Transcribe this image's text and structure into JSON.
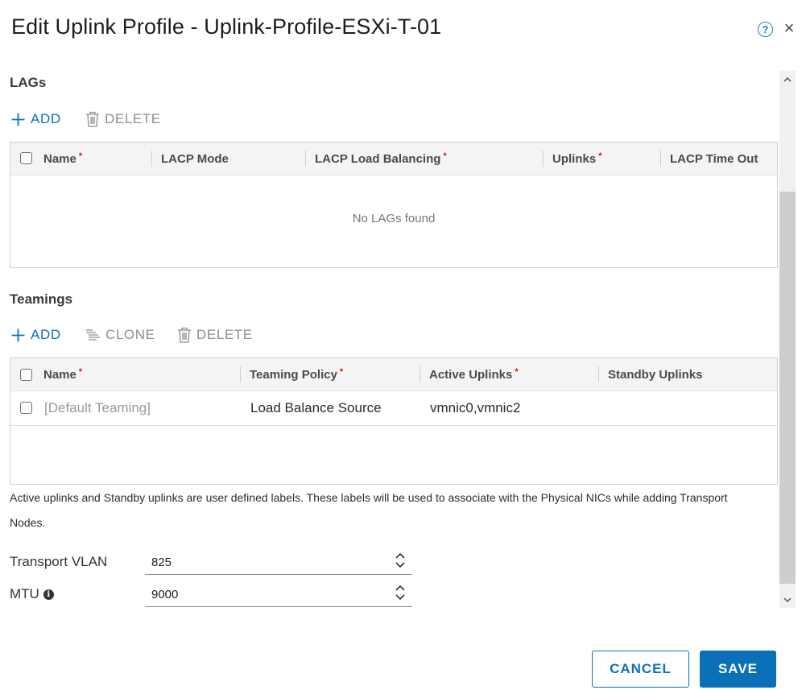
{
  "dialog": {
    "title": "Edit Uplink Profile - Uplink-Profile-ESXi-T-01",
    "help_glyph": "?",
    "close_glyph": "×"
  },
  "lags": {
    "section_title": "LAGs",
    "add_label": "ADD",
    "delete_label": "DELETE",
    "columns": [
      "Name",
      "LACP Mode",
      "LACP Load Balancing",
      "Uplinks",
      "LACP Time Out"
    ],
    "required_marker": "*",
    "empty_message": "No LAGs found"
  },
  "teamings": {
    "section_title": "Teamings",
    "add_label": "ADD",
    "clone_label": "CLONE",
    "delete_label": "DELETE",
    "columns": [
      "Name",
      "Teaming Policy",
      "Active Uplinks",
      "Standby Uplinks"
    ],
    "required_marker": "*",
    "rows": [
      {
        "name": "[Default Teaming]",
        "policy": "Load Balance Source",
        "active": "vmnic0,vmnic2",
        "standby": ""
      }
    ]
  },
  "note": "Active uplinks and Standby uplinks are user defined labels. These labels will be used to associate with the Physical NICs while adding Transport Nodes.",
  "fields": {
    "transport_vlan": {
      "label": "Transport VLAN",
      "value": "825"
    },
    "mtu": {
      "label": "MTU",
      "value": "9000",
      "info_glyph": "i"
    }
  },
  "footer": {
    "cancel_label": "CANCEL",
    "save_label": "SAVE"
  },
  "colors": {
    "accent": "#0a71b8",
    "required": "#c92100",
    "disabled": "#8e8e8e"
  },
  "icons": [
    "help-icon",
    "close-icon",
    "plus-icon",
    "trash-icon",
    "clone-icon",
    "info-icon",
    "spinner-icon",
    "scroll-up-icon",
    "scroll-down-icon"
  ]
}
